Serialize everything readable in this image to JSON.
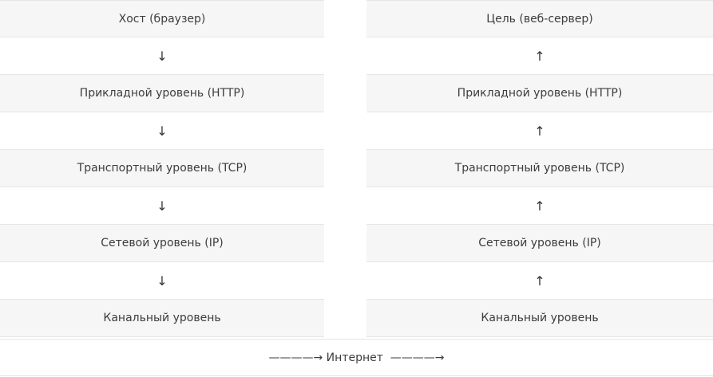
{
  "left_column": {
    "header": "Хост (браузер)",
    "arrow": "↓",
    "layers": [
      "Прикладной уровень (HTTP)",
      "Транспортный уровень (TCP)",
      "Сетевой уровень (IP)",
      "Канальный уровень"
    ]
  },
  "right_column": {
    "header": "Цель (веб-сервер)",
    "arrow": "↑",
    "layers": [
      "Прикладной уровень (HTTP)",
      "Транспортный уровень (TCP)",
      "Сетевой уровень (IP)",
      "Канальный уровень"
    ]
  },
  "footer": {
    "left_arrow": "————→",
    "label": "Интернет",
    "right_arrow": "————→"
  }
}
